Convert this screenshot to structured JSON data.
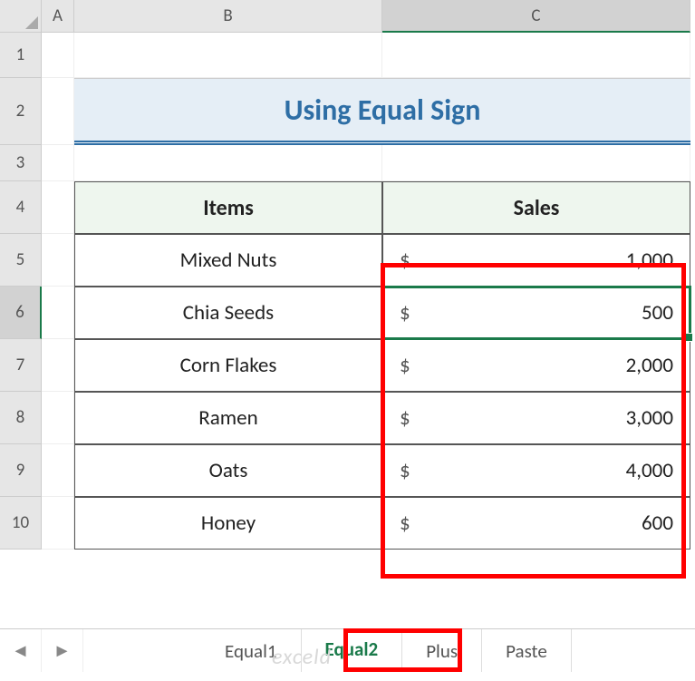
{
  "columns": [
    "A",
    "B",
    "C"
  ],
  "rows": [
    "1",
    "2",
    "3",
    "4",
    "5",
    "6",
    "7",
    "8",
    "9",
    "10"
  ],
  "selected_column": "C",
  "selected_row": "6",
  "title": "Using Equal Sign",
  "table": {
    "headers": {
      "items": "Items",
      "sales": "Sales"
    },
    "rows": [
      {
        "item": "Mixed Nuts",
        "currency": "$",
        "value": "1,000"
      },
      {
        "item": "Chia Seeds",
        "currency": "$",
        "value": "500"
      },
      {
        "item": "Corn Flakes",
        "currency": "$",
        "value": "2,000"
      },
      {
        "item": "Ramen",
        "currency": "$",
        "value": "3,000"
      },
      {
        "item": "Oats",
        "currency": "$",
        "value": "4,000"
      },
      {
        "item": "Honey",
        "currency": "$",
        "value": "600"
      }
    ]
  },
  "tabs": {
    "items": [
      "Equal1",
      "Equal2",
      "Plus",
      "Paste"
    ],
    "active": "Equal2"
  },
  "nav": {
    "prev": "◄",
    "next": "►"
  },
  "watermark": "exceld"
}
